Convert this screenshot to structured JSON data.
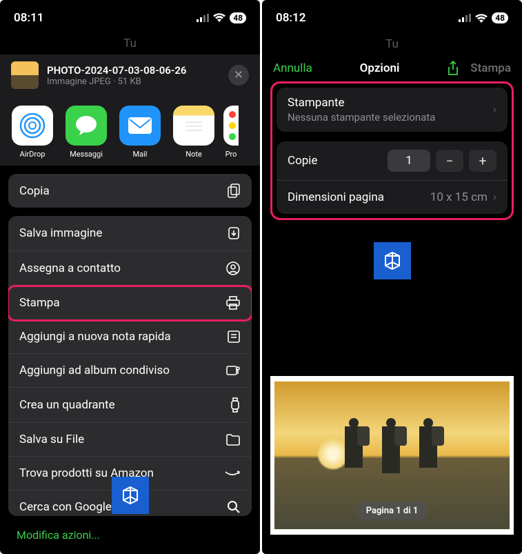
{
  "left": {
    "status_time": "08:11",
    "battery": "48",
    "dim_title": "Tu",
    "file": {
      "name": "PHOTO-2024-07-03-08-06-26",
      "sub": "Immagine JPEG · 51 KB"
    },
    "apps": [
      "AirDrop",
      "Messaggi",
      "Mail",
      "Note",
      "Pro"
    ],
    "copy_label": "Copia",
    "actions": [
      "Salva immagine",
      "Assegna a contatto",
      "Stampa",
      "Aggiungi a nuova nota rapida",
      "Aggiungi ad album condiviso",
      "Crea un quadrante",
      "Salva su File",
      "Trova prodotti su Amazon",
      "Cerca con Google Lens"
    ],
    "action_icons": [
      "download-icon",
      "contact-icon",
      "print-icon",
      "note-icon",
      "album-icon",
      "watchface-icon",
      "folder-icon",
      "amazon-icon",
      "search-icon"
    ],
    "highlighted_index": 2,
    "modify": "Modifica azioni..."
  },
  "right": {
    "status_time": "08:12",
    "battery": "48",
    "dim_title": "Tu",
    "nav": {
      "cancel": "Annulla",
      "title": "Opzioni",
      "print": "Stampa"
    },
    "printer": {
      "label": "Stampante",
      "sub": "Nessuna stampante selezionata"
    },
    "copies": {
      "label": "Copie",
      "value": "1"
    },
    "page_size": {
      "label": "Dimensioni pagina",
      "value": "10 x 15 cm"
    },
    "page_badge": "Pagina 1 di 1"
  }
}
